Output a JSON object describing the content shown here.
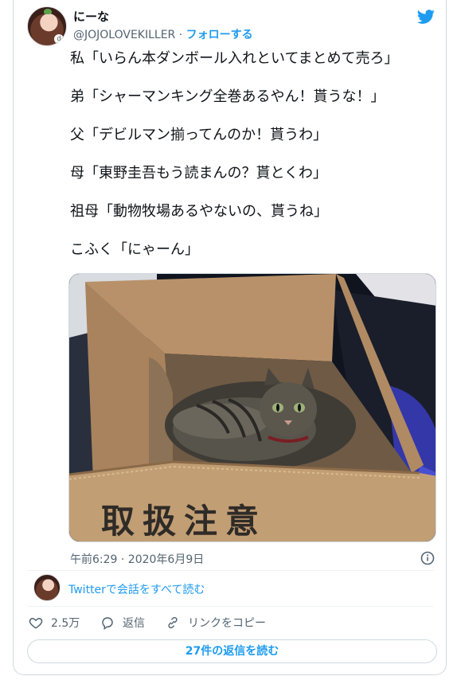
{
  "author": {
    "display_name": "にーな",
    "handle": "@JOJOLOVEKILLER",
    "separator": " · ",
    "follow_label": "フォローする"
  },
  "tweet": {
    "lines": [
      "私「いらん本ダンボール入れといてまとめて売ろ」",
      "弟「シャーマンキング全巻あるやん！貰うな！」",
      "父「デビルマン揃ってんのか！貰うわ」",
      "母「東野圭吾もう読まんの？貰とくわ」",
      "祖母「動物牧場あるやないの、貰うね」",
      "こふく「にゃーん」"
    ],
    "box_text": "取扱注意",
    "timestamp": "午前6:29 · 2020年6月9日"
  },
  "conversation": {
    "link_prefix": "Twitter",
    "link_suffix": "で会話をすべて読む"
  },
  "actions": {
    "likes": "2.5万",
    "reply_label": "返信",
    "copy_link_label": "リンクをコピー"
  },
  "read_replies_label": "27件の返信を読む",
  "colors": {
    "accent": "#1d9bf0",
    "secondary_text": "#536471",
    "border": "#cfd9de"
  },
  "icons": [
    "twitter-bird-icon",
    "info-icon",
    "heart-icon",
    "reply-icon",
    "link-icon"
  ]
}
